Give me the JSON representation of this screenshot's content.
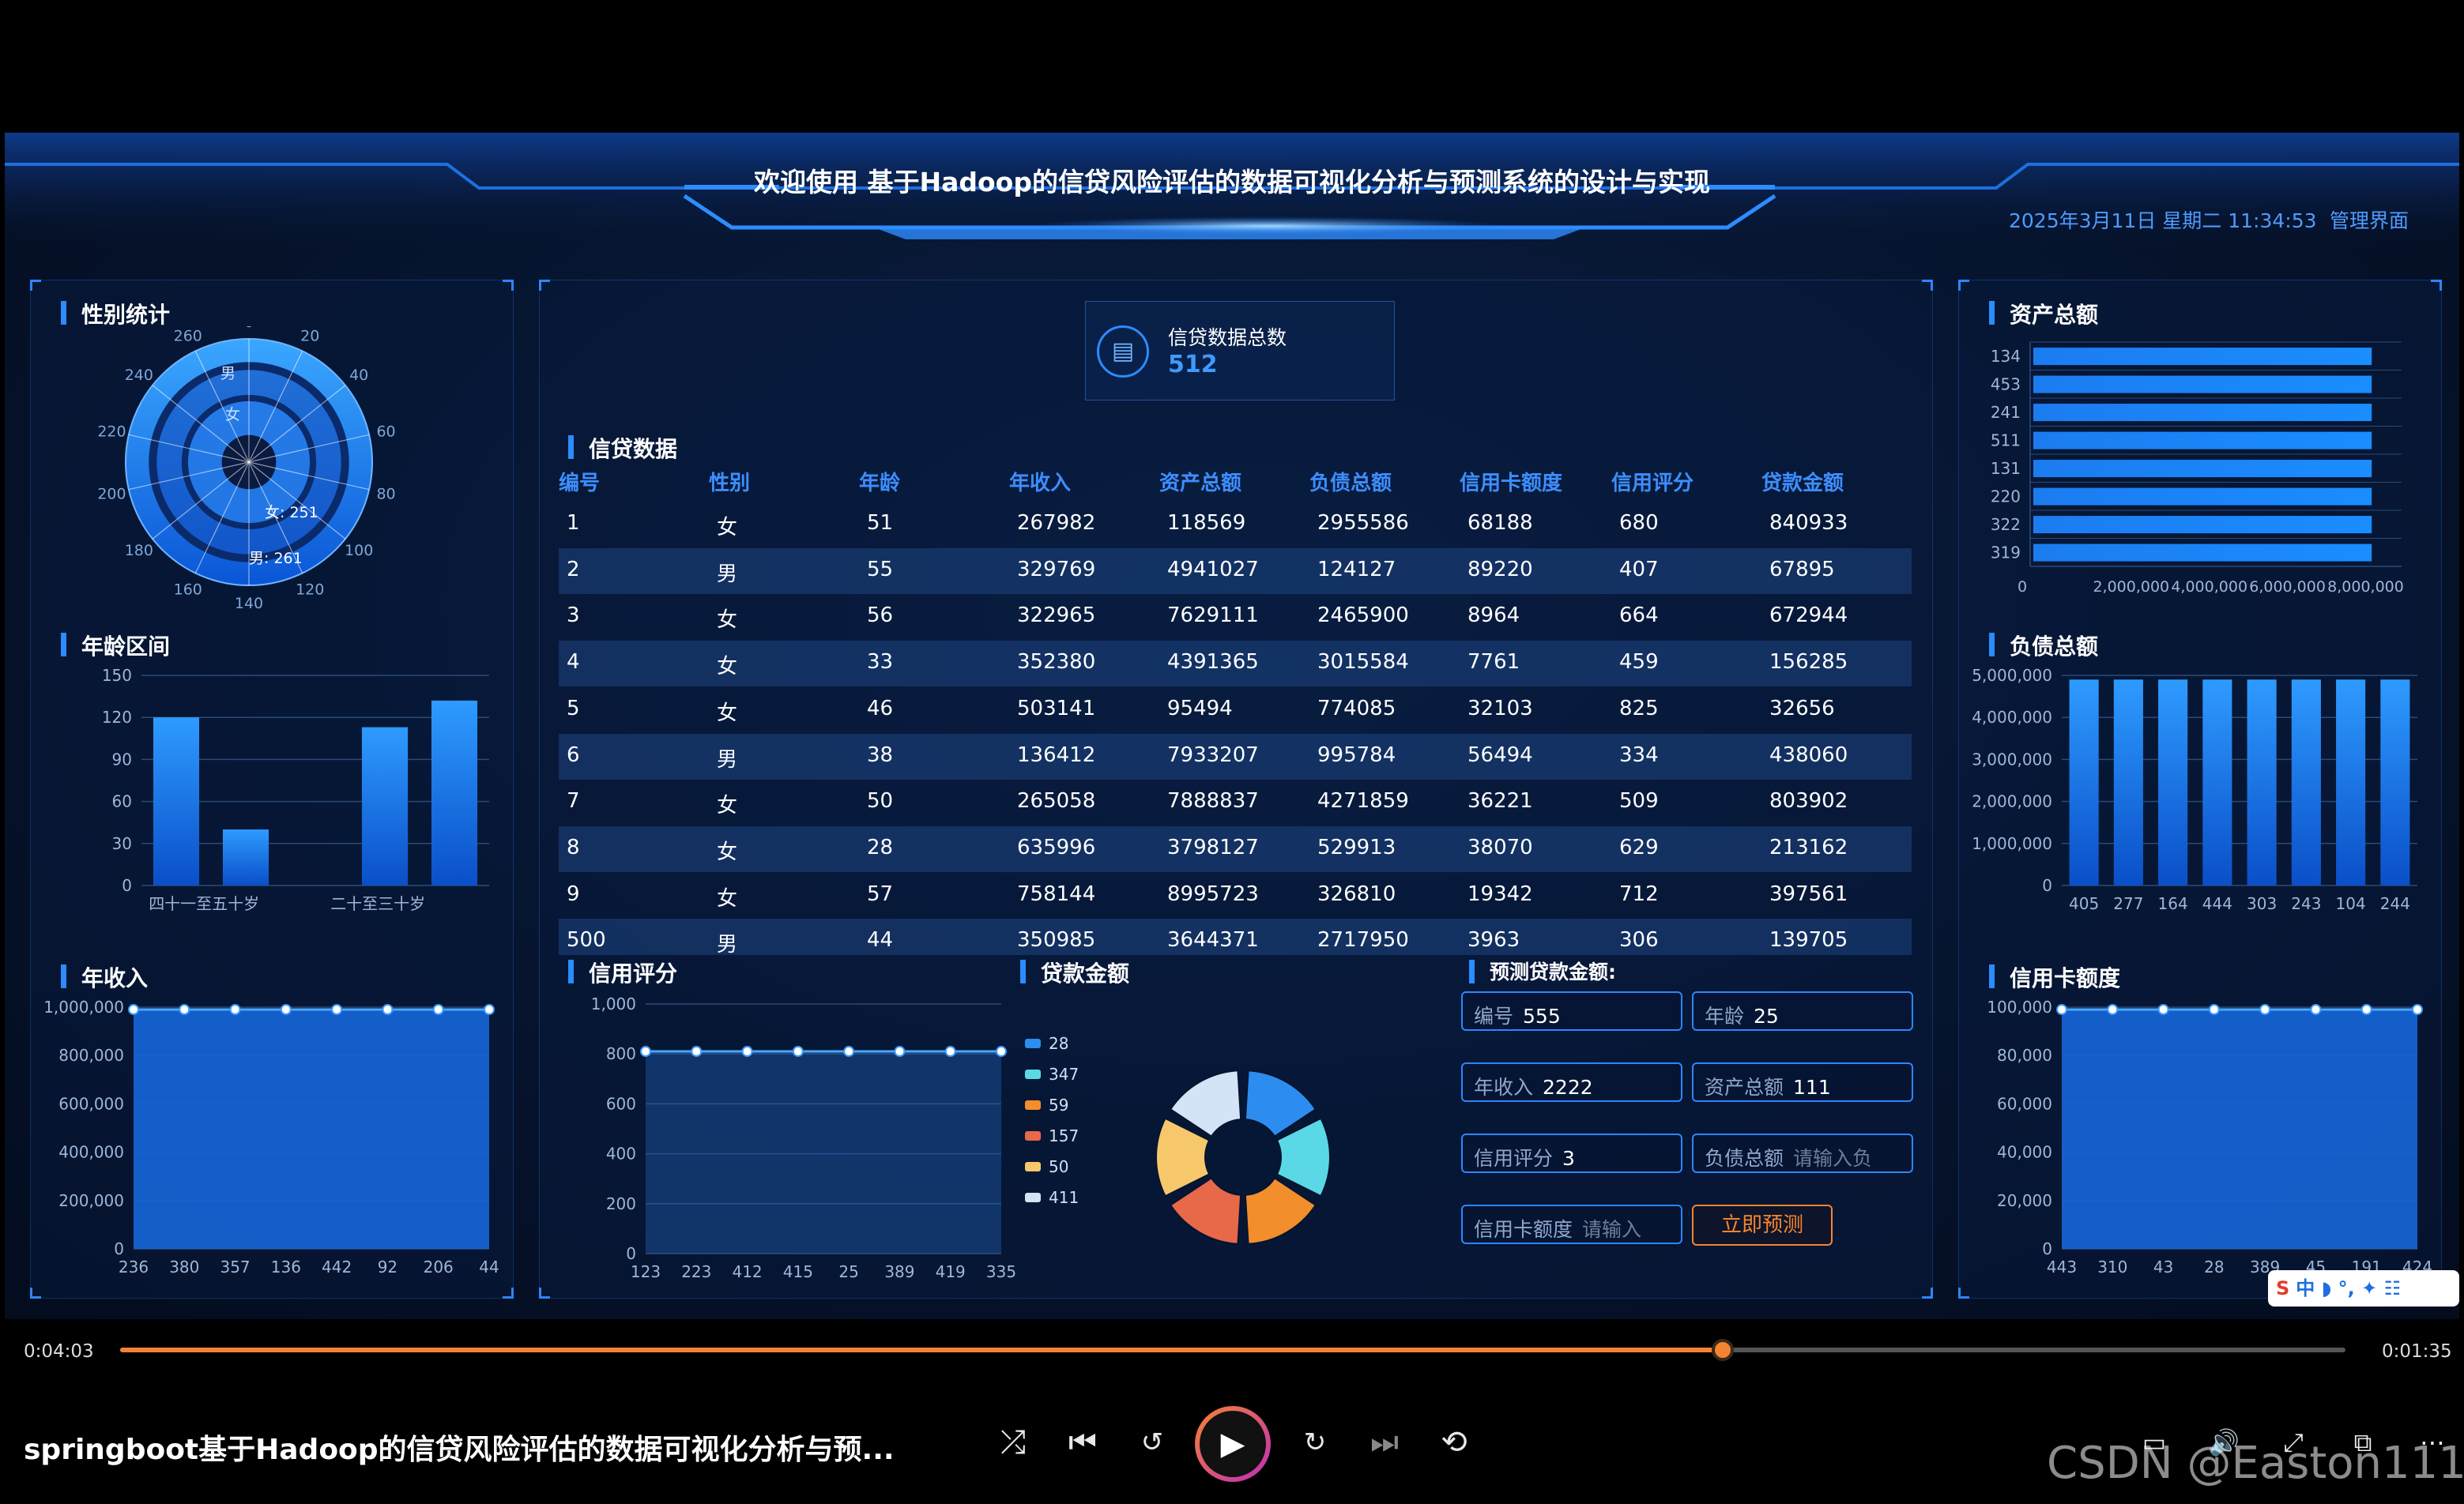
{
  "header": {
    "title": "欢迎使用 基于Hadoop的信贷风险评估的数据可视化分析与预测系统的设计与实现",
    "datetime": "2025年3月11日 星期二 11:34:53",
    "admin_link": "管理界面"
  },
  "colors": {
    "accent": "#2b8cff",
    "header_blue": "#1e6fe0",
    "orange": "#f48432",
    "bg": "#06142e"
  },
  "gender": {
    "title": "性别统计",
    "angle_ticks": [
      "0",
      "20",
      "40",
      "60",
      "80",
      "100",
      "120",
      "140",
      "160",
      "180",
      "200",
      "220",
      "240",
      "260"
    ],
    "male_label": "男: 261",
    "female_label": "女: 251",
    "male_short": "男",
    "female_short": "女",
    "male": 261,
    "female": 251
  },
  "age": {
    "title": "年龄区间",
    "yticks": [
      "150",
      "120",
      "90",
      "60",
      "30",
      "0"
    ],
    "ymax": 150,
    "xlabels": [
      "四十一至五十岁",
      "二十至三十岁"
    ],
    "values": [
      120,
      40,
      0,
      113,
      132
    ]
  },
  "income_chart": {
    "title": "年收入",
    "yticks": [
      "1,000,000",
      "800,000",
      "600,000",
      "400,000",
      "200,000",
      "0"
    ],
    "ymax": 1000000,
    "xlabels": [
      "236",
      "380",
      "357",
      "136",
      "442",
      "92",
      "206",
      "44"
    ],
    "values": [
      990000,
      990000,
      990000,
      990000,
      990000,
      990000,
      990000,
      990000
    ]
  },
  "total": {
    "label": "信贷数据总数",
    "value": "512"
  },
  "table": {
    "title": "信贷数据",
    "headers": [
      "编号",
      "性别",
      "年龄",
      "年收入",
      "资产总额",
      "负债总额",
      "信用卡额度",
      "信用评分",
      "贷款金额"
    ],
    "rows": [
      [
        "1",
        "女",
        "51",
        "267982",
        "118569",
        "2955586",
        "68188",
        "680",
        "840933"
      ],
      [
        "2",
        "男",
        "55",
        "329769",
        "4941027",
        "124127",
        "89220",
        "407",
        "67895"
      ],
      [
        "3",
        "女",
        "56",
        "322965",
        "7629111",
        "2465900",
        "8964",
        "664",
        "672944"
      ],
      [
        "4",
        "女",
        "33",
        "352380",
        "4391365",
        "3015584",
        "7761",
        "459",
        "156285"
      ],
      [
        "5",
        "女",
        "46",
        "503141",
        "95494",
        "774085",
        "32103",
        "825",
        "32656"
      ],
      [
        "6",
        "男",
        "38",
        "136412",
        "7933207",
        "995784",
        "56494",
        "334",
        "438060"
      ],
      [
        "7",
        "女",
        "50",
        "265058",
        "7888837",
        "4271859",
        "36221",
        "509",
        "803902"
      ],
      [
        "8",
        "女",
        "28",
        "635996",
        "3798127",
        "529913",
        "38070",
        "629",
        "213162"
      ],
      [
        "9",
        "女",
        "57",
        "758144",
        "8995723",
        "326810",
        "19342",
        "712",
        "397561"
      ],
      [
        "500",
        "男",
        "44",
        "350985",
        "3644371",
        "2717950",
        "3963",
        "306",
        "139705"
      ]
    ]
  },
  "credit_score": {
    "title": "信用评分",
    "yticks": [
      "1,000",
      "800",
      "600",
      "400",
      "200",
      "0"
    ],
    "ymax": 1000,
    "xlabels": [
      "123",
      "223",
      "412",
      "415",
      "25",
      "389",
      "419",
      "335"
    ],
    "values": [
      810,
      810,
      810,
      810,
      810,
      810,
      810,
      810
    ]
  },
  "loan_amount": {
    "title": "贷款金额",
    "legend": [
      {
        "label": "28",
        "color": "#2d8cf0"
      },
      {
        "label": "347",
        "color": "#5ad8e6"
      },
      {
        "label": "59",
        "color": "#f28e2b"
      },
      {
        "label": "157",
        "color": "#e8684a"
      },
      {
        "label": "50",
        "color": "#f6c86b"
      },
      {
        "label": "411",
        "color": "#d4e3f5"
      }
    ]
  },
  "predict": {
    "title": "预测贷款金额:",
    "fields": [
      {
        "label": "编号",
        "value": "555",
        "placeholder": ""
      },
      {
        "label": "年龄",
        "value": "25",
        "placeholder": ""
      },
      {
        "label": "年收入",
        "value": "2222",
        "placeholder": ""
      },
      {
        "label": "资产总额",
        "value": "111",
        "placeholder": ""
      },
      {
        "label": "信用评分",
        "value": "3",
        "placeholder": ""
      },
      {
        "label": "负债总额",
        "value": "",
        "placeholder": "请输入负"
      },
      {
        "label": "信用卡额度",
        "value": "",
        "placeholder": "请输入"
      }
    ],
    "button": "立即预测"
  },
  "assets": {
    "title": "资产总额",
    "categories": [
      "134",
      "453",
      "241",
      "511",
      "131",
      "220",
      "322",
      "319"
    ],
    "xticks": [
      "0",
      "2,000,000",
      "4,000,000",
      "6,000,000",
      "8,000,000"
    ],
    "xmax": 9000000,
    "values": [
      8200000,
      8200000,
      8200000,
      8200000,
      8200000,
      8200000,
      8200000,
      8200000
    ]
  },
  "debt": {
    "title": "负债总额",
    "yticks": [
      "5,000,000",
      "4,000,000",
      "3,000,000",
      "2,000,000",
      "1,000,000",
      "0"
    ],
    "ymax": 5000000,
    "xlabels": [
      "405",
      "277",
      "164",
      "444",
      "303",
      "243",
      "104",
      "244"
    ],
    "values": [
      4900000,
      4900000,
      4900000,
      4900000,
      4900000,
      4900000,
      4900000,
      4900000
    ]
  },
  "credit_limit": {
    "title": "信用卡额度",
    "yticks": [
      "100,000",
      "80,000",
      "60,000",
      "40,000",
      "20,000",
      "0"
    ],
    "ymax": 100000,
    "xlabels": [
      "443",
      "310",
      "43",
      "28",
      "389",
      "45",
      "191",
      "424"
    ],
    "values": [
      99000,
      99000,
      99000,
      99000,
      99000,
      99000,
      99000,
      99000
    ]
  },
  "player": {
    "current_time": "0:04:03",
    "remaining": "0:01:35",
    "progress": 0.72,
    "video_title": "springboot基于Hadoop的信贷风险评估的数据可视化分析与预...",
    "watermark": "CSDN @Easton111"
  }
}
